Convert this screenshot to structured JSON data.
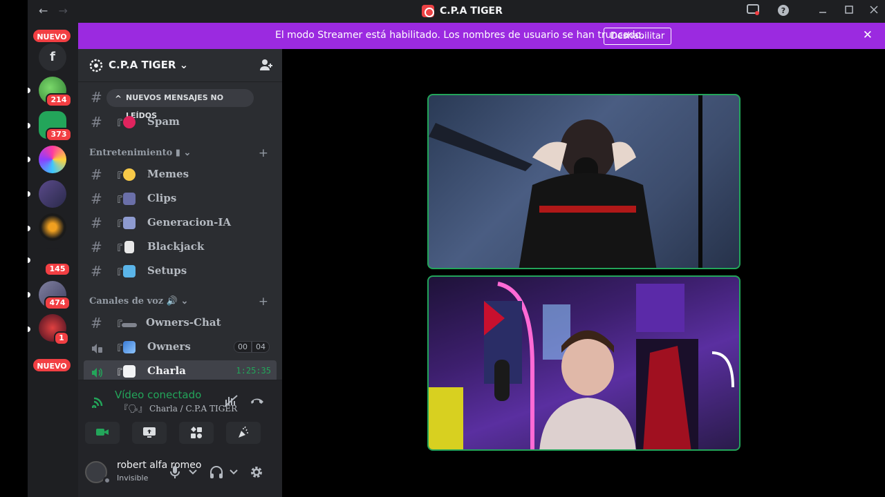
{
  "window": {
    "title": "C.P.A TIGER",
    "back": "←",
    "forward": "→"
  },
  "banner": {
    "text": "El modo Streamer está habilitado. Los nombres de usuario se han truncado.",
    "button": "Deshabilitar",
    "close": "✕"
  },
  "rail": {
    "top_badge": "NUEVO",
    "bottom_badge": "NUEVO",
    "facebook_letter": "f",
    "badges": [
      "214",
      "373",
      "145",
      "474",
      "1"
    ]
  },
  "server": {
    "name": "C.P.A TIGER",
    "unread_pill": "NUEVOS MENSAJES NO LEÍDOS"
  },
  "channels": {
    "top": [
      {
        "name": "Spam",
        "hash": "#",
        "bracket": "『"
      }
    ],
    "entertainment_label": "Entretenimiento",
    "entertainment": [
      {
        "name": "Memes",
        "hash": "#",
        "bracket": "『"
      },
      {
        "name": "Clips",
        "hash": "#",
        "bracket": "『"
      },
      {
        "name": "Generacion-IA",
        "hash": "#",
        "bracket": "『"
      },
      {
        "name": "Blackjack",
        "hash": "#",
        "bracket": "『"
      },
      {
        "name": "Setups",
        "hash": "#",
        "bracket": "『"
      }
    ],
    "voice_label": "Canales de voz",
    "voice": [
      {
        "name": "Owners-Chat",
        "bracket": "『"
      },
      {
        "name": "Owners",
        "bracket": "『",
        "count_a": "00",
        "count_b": "04"
      },
      {
        "name": "Charla",
        "bracket": "『",
        "timer": "1:25:35"
      }
    ]
  },
  "voice_panel": {
    "status": "Vídeo conectado",
    "sub": "『🗣』 Charla / C.P.A TIGER"
  },
  "user": {
    "name": "robert alfa romeo",
    "status": "Invisible"
  },
  "colors": {
    "accent_green": "#23a55a",
    "banner_purple": "#9b2ae0",
    "badge_red": "#f23f43"
  }
}
